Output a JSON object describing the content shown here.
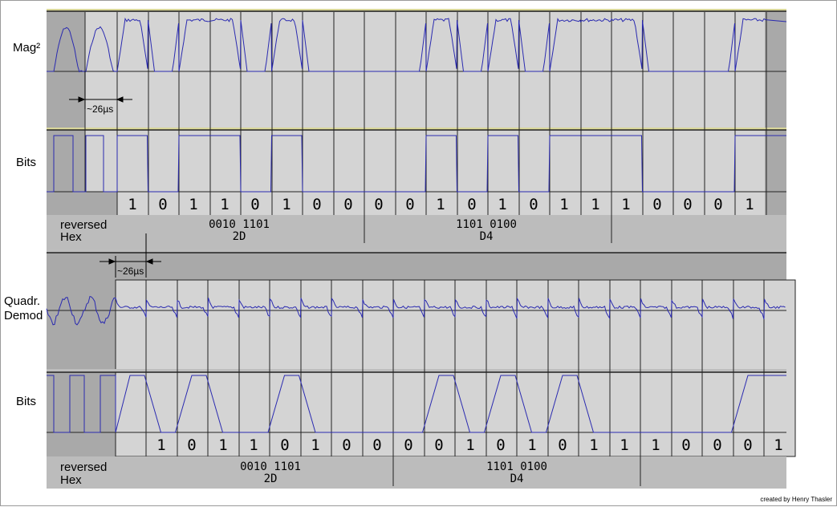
{
  "panels": [
    {
      "signal_label": "Mag²",
      "bits_label": "Bits",
      "decode_label_line1": "reversed",
      "decode_label_line2": "Hex",
      "interval_annotation": "~26µs",
      "bits": [
        "1",
        "0",
        "1",
        "1",
        "0",
        "1",
        "0",
        "0",
        "0",
        "0",
        "1",
        "0",
        "1",
        "0",
        "1",
        "1",
        "1",
        "0",
        "0",
        "0",
        "1"
      ],
      "bytes": [
        {
          "binary": "0010 1101",
          "hex": "2D"
        },
        {
          "binary": "1101 0100",
          "hex": "D4"
        }
      ]
    },
    {
      "signal_label_line1": "Quadr.",
      "signal_label_line2": "Demod",
      "bits_label": "Bits",
      "decode_label_line1": "reversed",
      "decode_label_line2": "Hex",
      "interval_annotation": "~26µs",
      "bits": [
        "1",
        "0",
        "1",
        "1",
        "0",
        "1",
        "0",
        "0",
        "0",
        "0",
        "1",
        "0",
        "1",
        "0",
        "1",
        "1",
        "1",
        "0",
        "0",
        "0",
        "1"
      ],
      "bytes": [
        {
          "binary": "0010 1101",
          "hex": "2D"
        },
        {
          "binary": "1101 0100",
          "hex": "D4"
        }
      ]
    }
  ],
  "credit": "created by Henry Thasler",
  "colors": {
    "trace": "#2a2ab0",
    "panel_gray": "#d4d4d4",
    "dark_gray": "#a9a9a9",
    "sync_gray": "#bdbdbd"
  }
}
